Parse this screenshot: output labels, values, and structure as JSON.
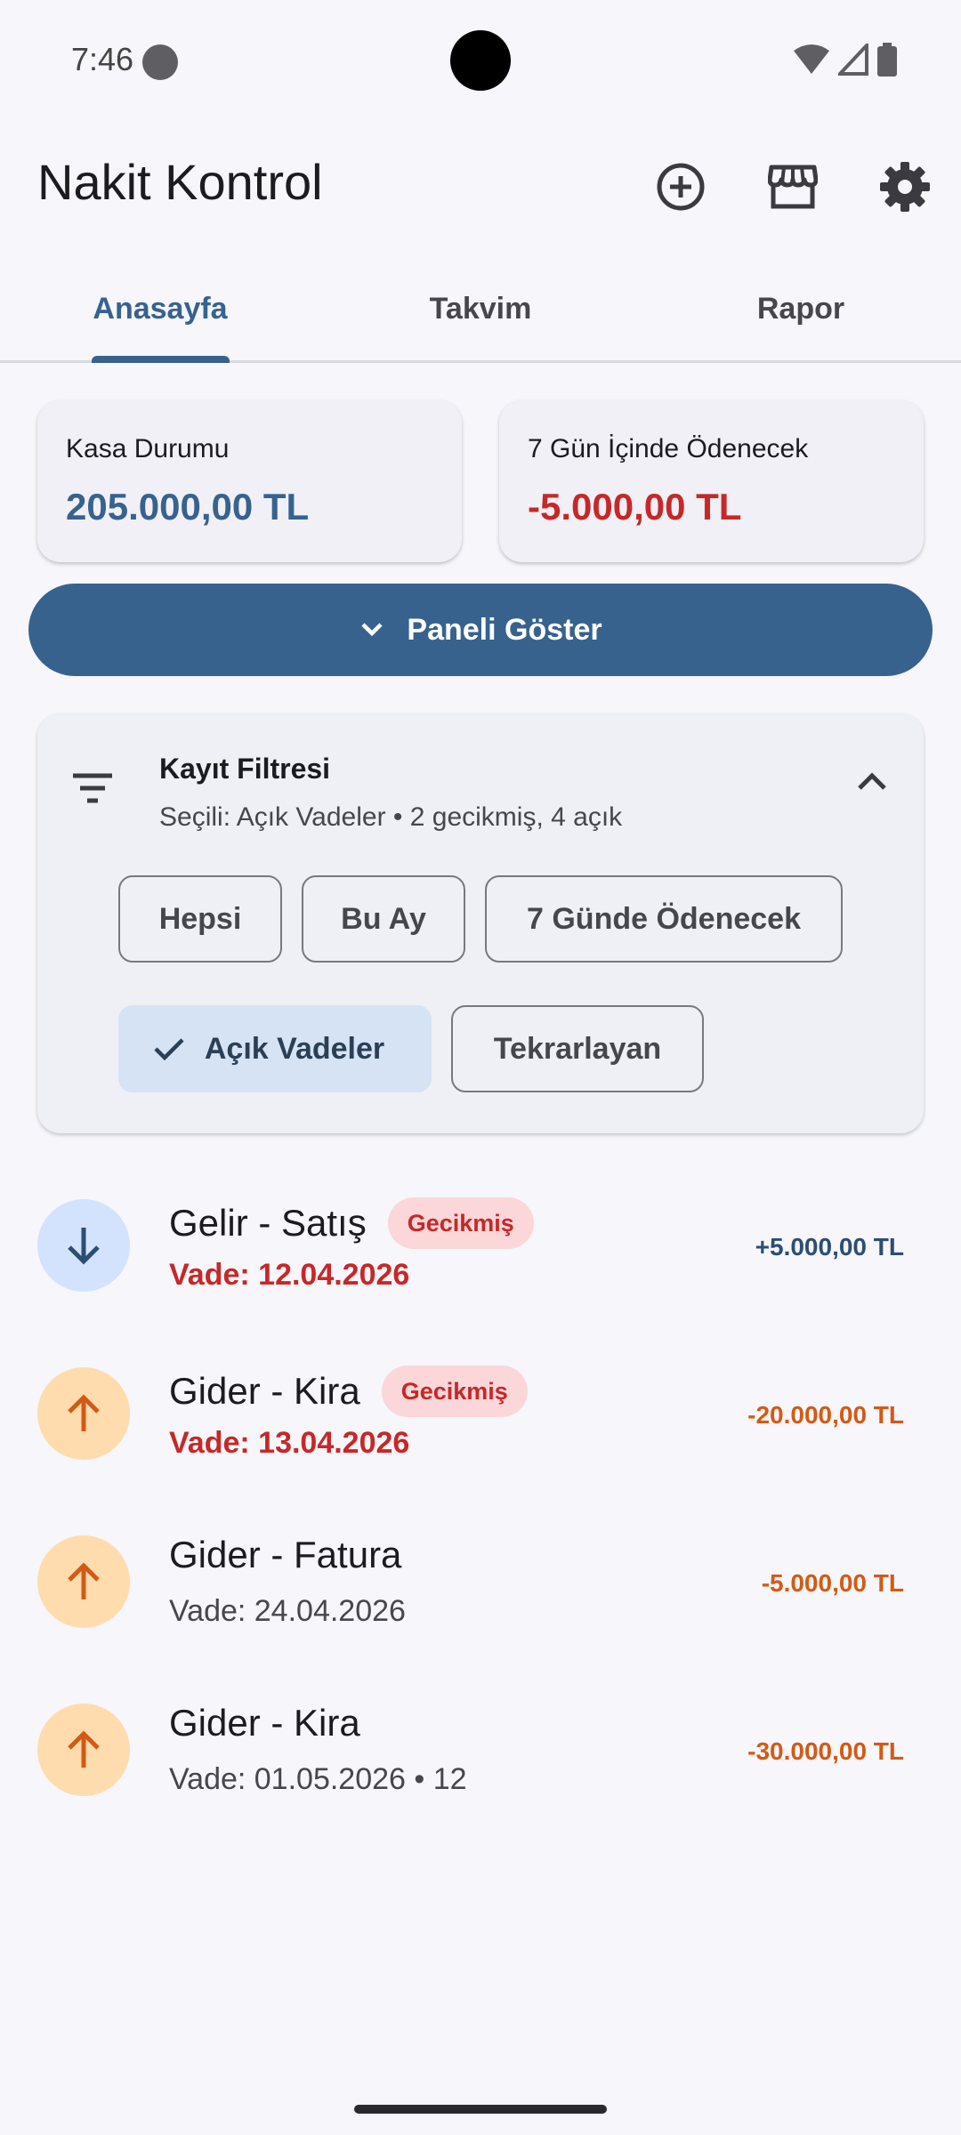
{
  "status_bar": {
    "time": "7:46"
  },
  "app_bar": {
    "title": "Nakit Kontrol",
    "actions": [
      "add-circle-icon",
      "storefront-icon",
      "settings-icon"
    ]
  },
  "tabs": [
    {
      "label": "Anasayfa",
      "active": true
    },
    {
      "label": "Takvim",
      "active": false
    },
    {
      "label": "Rapor",
      "active": false
    }
  ],
  "summary": {
    "cash": {
      "label": "Kasa Durumu",
      "value": "205.000,00 TL"
    },
    "due7": {
      "label": "7 Gün İçinde Ödenecek",
      "value": "-5.000,00 TL"
    }
  },
  "panel_button": {
    "label": "Paneli Göster"
  },
  "filter": {
    "title": "Kayıt Filtresi",
    "subtitle": "Seçili: Açık Vadeler • 2 gecikmiş, 4 açık",
    "chips_row1": [
      "Hepsi",
      "Bu Ay",
      "7 Günde Ödenecek"
    ],
    "chips_row2": {
      "selected": "Açık Vadeler",
      "other": "Tekrarlayan"
    }
  },
  "items": [
    {
      "title": "Gelir - Satış",
      "badge": "Gecikmiş",
      "sub": "Vade: 12.04.2026",
      "amount": "+5.000,00 TL",
      "kind": "income",
      "overdue": true
    },
    {
      "title": "Gider - Kira",
      "badge": "Gecikmiş",
      "sub": "Vade: 13.04.2026",
      "amount": "-20.000,00 TL",
      "kind": "expense",
      "overdue": true
    },
    {
      "title": "Gider - Fatura",
      "sub": "Vade: 24.04.2026",
      "amount": "-5.000,00 TL",
      "kind": "expense",
      "overdue": false
    },
    {
      "title": "Gider - Kira",
      "sub": "Vade: 01.05.2026 • 12",
      "amount": "-30.000,00 TL",
      "kind": "expense",
      "overdue": false
    }
  ],
  "colors": {
    "primary": "#37628e",
    "negative": "#c62828",
    "expense": "#d35a14",
    "background": "#f6f6fb"
  }
}
